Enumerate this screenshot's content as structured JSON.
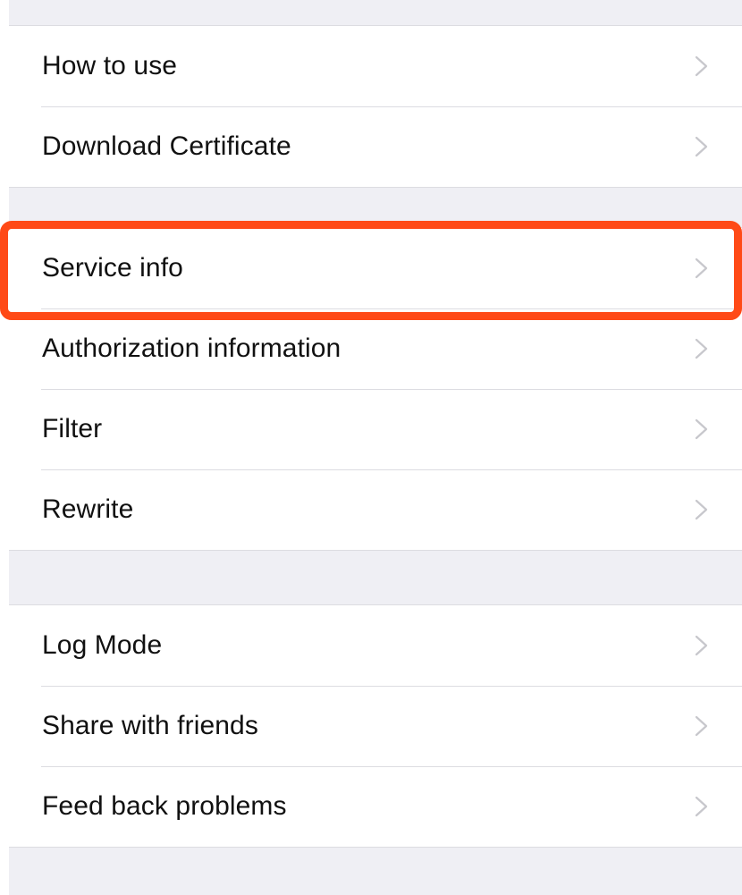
{
  "settings": {
    "groups": [
      {
        "items": [
          {
            "label": "How to use",
            "icon": "chevron-right-icon"
          },
          {
            "label": "Download Certificate",
            "icon": "chevron-right-icon"
          }
        ]
      },
      {
        "items": [
          {
            "label": "Service info",
            "icon": "chevron-right-icon",
            "highlighted": true
          },
          {
            "label": "Authorization information",
            "icon": "chevron-right-icon"
          },
          {
            "label": "Filter",
            "icon": "chevron-right-icon"
          },
          {
            "label": "Rewrite",
            "icon": "chevron-right-icon"
          }
        ]
      },
      {
        "items": [
          {
            "label": "Log Mode",
            "icon": "chevron-right-icon"
          },
          {
            "label": "Share with friends",
            "icon": "chevron-right-icon"
          },
          {
            "label": "Feed back problems",
            "icon": "chevron-right-icon"
          }
        ]
      }
    ]
  },
  "colors": {
    "background": "#efeff4",
    "cell": "#ffffff",
    "separator": "#dcdce1",
    "chevron": "#c7c7cc",
    "highlight": "#ff4a17"
  }
}
